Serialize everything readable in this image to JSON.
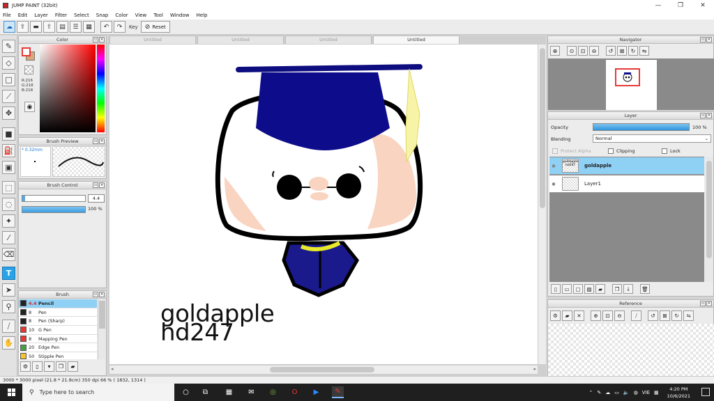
{
  "window": {
    "title": "JUMP PAINT (32bit)",
    "min": "—",
    "max": "❐",
    "close": "✕"
  },
  "menu": [
    "File",
    "Edit",
    "Layer",
    "Filter",
    "Select",
    "Snap",
    "Color",
    "View",
    "Tool",
    "Window",
    "Help"
  ],
  "toolbar": {
    "key_label": "Key",
    "reset_label": "Reset"
  },
  "color_panel": {
    "title": "Color",
    "r": "R:216",
    "g": "G:218",
    "b": "B:218",
    "colors": {
      "fg": "#e53935",
      "bg": "#d8a878"
    }
  },
  "brush_preview": {
    "title": "Brush Preview",
    "size": "* 0.32mm"
  },
  "brush_control": {
    "title": "Brush Control",
    "size_value": "4.4",
    "opacity_value": "100 %"
  },
  "brush_panel": {
    "title": "Brush",
    "items": [
      {
        "size": "4.4",
        "name": "Pencil",
        "color": "#222222"
      },
      {
        "size": "8",
        "name": "Pen",
        "color": "#222222"
      },
      {
        "size": "8",
        "name": "Pen (Sharp)",
        "color": "#222222"
      },
      {
        "size": "10",
        "name": "G Pen",
        "color": "#e53935"
      },
      {
        "size": "8",
        "name": "Mapping Pen",
        "color": "#e53935"
      },
      {
        "size": "20",
        "name": "Edge Pen",
        "color": "#43a047"
      },
      {
        "size": "50",
        "name": "Stipple Pen",
        "color": "#fbc02d"
      }
    ]
  },
  "tabs": [
    "Untitled",
    "Untitled",
    "Untitled",
    "Untitled"
  ],
  "canvas": {
    "signature_line1": "goldapple",
    "signature_line2": "hd247"
  },
  "navigator": {
    "title": "Navigator"
  },
  "layer_panel": {
    "title": "Layer",
    "opacity_label": "Opacity",
    "opacity_value": "100 %",
    "blending_label": "Blending",
    "blending_value": "Normal",
    "protect_alpha": "Protect Alpha",
    "clipping": "Clipping",
    "lock": "Lock",
    "layers": [
      {
        "name": "goldapple",
        "thumb_text": "goldapple hd247"
      },
      {
        "name": "Layer1"
      }
    ]
  },
  "reference": {
    "title": "Reference"
  },
  "status": {
    "text": "3000 * 3000 pixel  (21.8 * 21.8cm)  350 dpi  66 %  ( 1832, 1314 )"
  },
  "taskbar": {
    "search_placeholder": "Type here to search",
    "lang": "VIE",
    "time": "4:20 PM",
    "date": "10/6/2021"
  }
}
